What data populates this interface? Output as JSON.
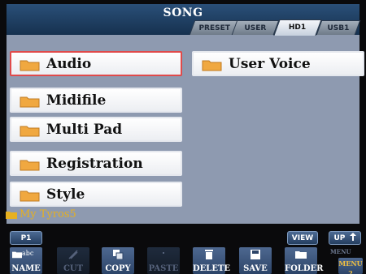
{
  "title": "SONG",
  "tabs": [
    {
      "label": "PRESET",
      "active": false
    },
    {
      "label": "USER",
      "active": false
    },
    {
      "label": "HD1",
      "active": true
    },
    {
      "label": "USB1",
      "active": false
    }
  ],
  "folders_left": [
    {
      "label": "Audio",
      "selected": true
    },
    {
      "label": "Midifile",
      "selected": false
    },
    {
      "label": "Multi Pad",
      "selected": false
    },
    {
      "label": "Registration",
      "selected": false
    },
    {
      "label": "Style",
      "selected": false
    }
  ],
  "folders_right": [
    {
      "label": "User Voice",
      "selected": false
    }
  ],
  "current_path": "My Tyros5",
  "page": {
    "label": "P1"
  },
  "view_button": "VIEW",
  "up_button": "UP",
  "function_buttons": [
    {
      "label": "NAME",
      "sublabel": "abc",
      "enabled": true,
      "icon": "folder-abc-icon"
    },
    {
      "label": "CUT",
      "enabled": false,
      "icon": "scissors-icon"
    },
    {
      "label": "COPY",
      "enabled": true,
      "icon": "copy-icon"
    },
    {
      "label": "PASTE",
      "enabled": false,
      "icon": "paste-icon"
    },
    {
      "label": "DELETE",
      "enabled": true,
      "icon": "trash-icon"
    },
    {
      "label": "SAVE",
      "enabled": true,
      "icon": "disk-icon"
    },
    {
      "label": "FOLDER",
      "enabled": true,
      "icon": "folder-icon"
    }
  ],
  "menu_button": {
    "top_label": "MENU",
    "label": "MENU",
    "number": "2"
  },
  "colors": {
    "selection_border": "#e04a4a",
    "folder": "#f0a840",
    "path_text": "#e6b020",
    "panel": "#8e9ab0"
  }
}
